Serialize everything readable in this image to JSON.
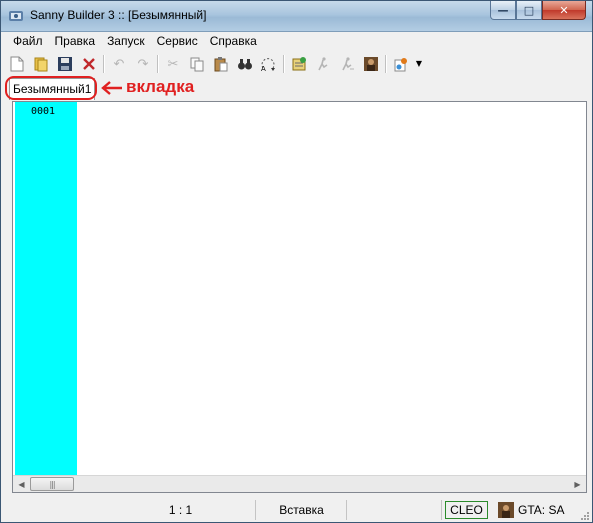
{
  "window": {
    "title": "Sanny Builder 3 :: [Безымянный]",
    "buttons": {
      "minimize": "—",
      "maximize": "□",
      "close": "✕"
    }
  },
  "menu": [
    "Файл",
    "Правка",
    "Запуск",
    "Сервис",
    "Справка"
  ],
  "toolbar": {
    "icons": [
      "new-file",
      "open-folder",
      "save",
      "close-file",
      "undo",
      "redo",
      "cut",
      "copy",
      "paste",
      "find",
      "find-next",
      "compile",
      "run",
      "decompile",
      "gta-character",
      "options"
    ]
  },
  "tabs": [
    {
      "label": "Безымянный1",
      "active": true
    }
  ],
  "annotation": {
    "label": "вкладка",
    "color": "#e02020"
  },
  "editor": {
    "gutter_color": "#00ffff",
    "line_numbers": [
      "0001"
    ]
  },
  "statusbar": {
    "position": "1 :  1",
    "mode": "Вставка",
    "cleo": "CLEO",
    "game": "GTA: SA"
  }
}
